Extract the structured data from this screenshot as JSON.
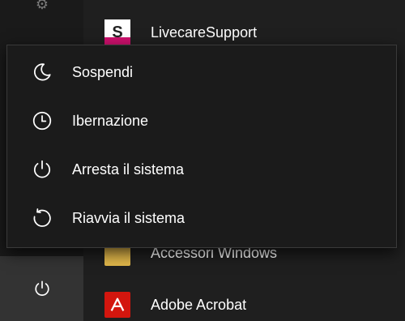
{
  "apps": [
    {
      "label": "LivecareSupport",
      "icon": "livecaresupport-icon",
      "tile_color": "#ffffff",
      "glyph": "S",
      "glyph_color": "#d0106e"
    },
    {
      "label": "Accessori Windows",
      "icon": "folder-icon",
      "tile_color": "#e0b64a"
    },
    {
      "label": "Adobe Acrobat",
      "icon": "adobe-acrobat-icon",
      "tile_color": "#d3160e",
      "glyph": "ʎ",
      "glyph_color": "#ffffff"
    }
  ],
  "power_menu": {
    "items": [
      {
        "label": "Sospendi",
        "icon": "moon-icon"
      },
      {
        "label": "Ibernazione",
        "icon": "clock-icon"
      },
      {
        "label": "Arresta il sistema",
        "icon": "power-icon"
      },
      {
        "label": "Riavvia il sistema",
        "icon": "restart-icon"
      }
    ]
  },
  "rail": {
    "power_icon": "power-icon",
    "power_highlight": "#333333"
  },
  "colors": {
    "menu_bg": "#1b1b1b",
    "text": "#ffffff"
  }
}
